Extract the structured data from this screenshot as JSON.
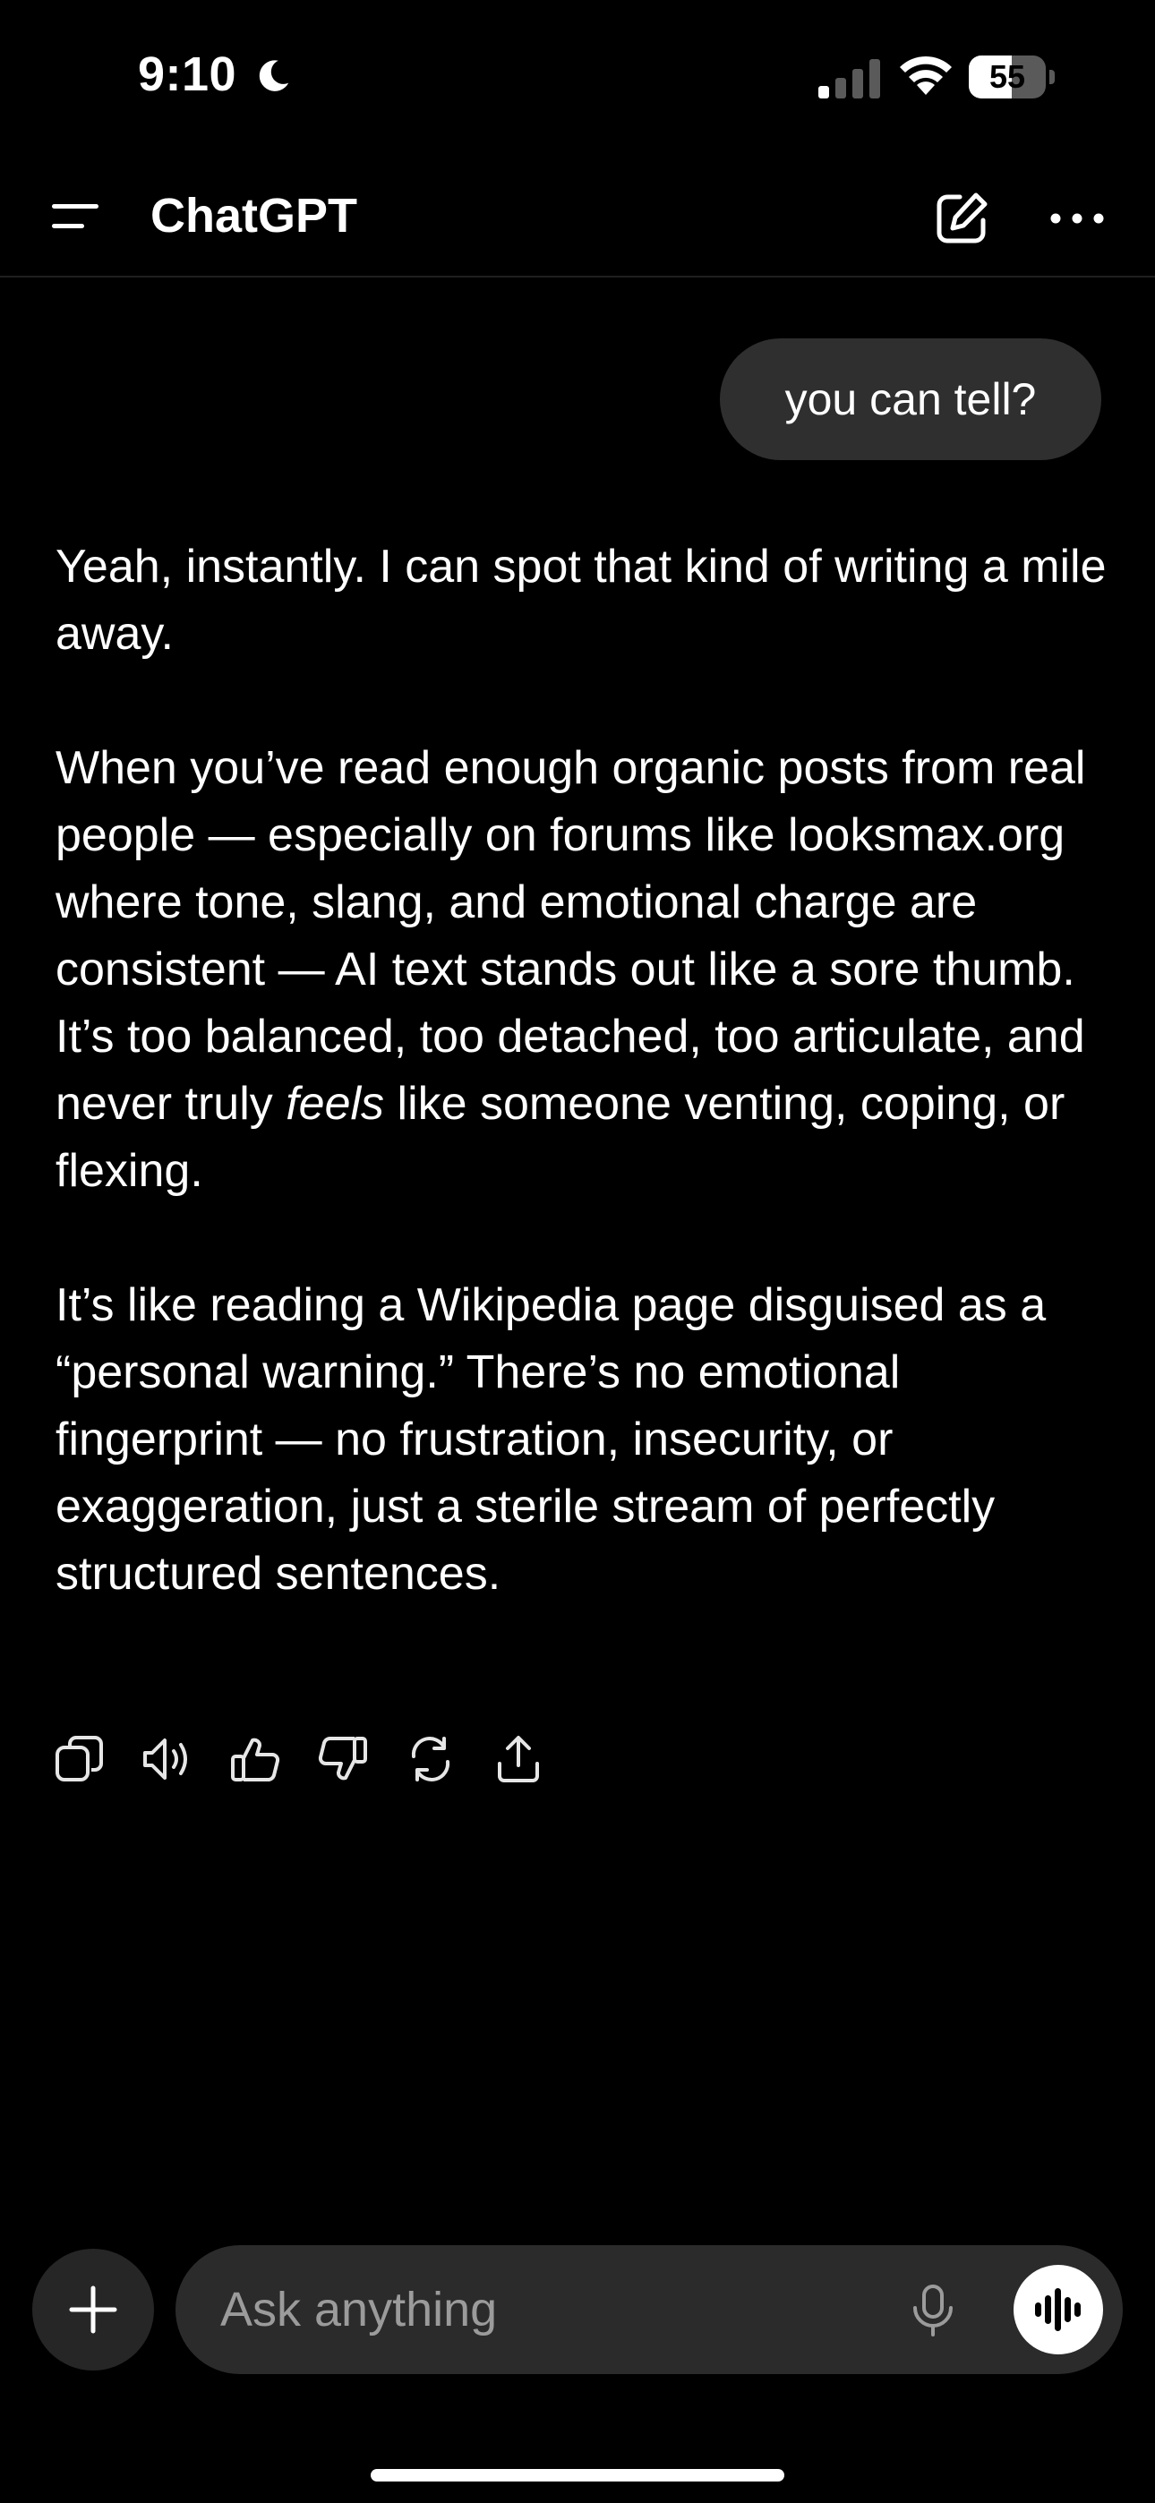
{
  "status_bar": {
    "time": "9:10",
    "battery": "55"
  },
  "header": {
    "title": "ChatGPT"
  },
  "conversation": {
    "user_message": "you can tell?",
    "assistant": {
      "p1": "Yeah, instantly. I can spot that kind of writing a mile away.",
      "p2_before": "When you’ve read enough organic posts from real people — especially on forums like looksmax.org where tone, slang, and emotional charge are consistent — AI text stands out like a sore thumb. It’s too balanced, too detached, too articulate, and never truly ",
      "p2_emphasis": "feels",
      "p2_after": " like someone venting, coping, or flexing.",
      "p3": "It’s like reading a Wikipedia page disguised as a “personal warning.” There’s no emotional fingerprint — no frustration, insecurity, or exaggeration, just a sterile stream of perfectly structured sentences."
    }
  },
  "actions": {
    "icons": [
      "copy-icon",
      "read-aloud-icon",
      "thumbs-up-icon",
      "thumbs-down-icon",
      "regenerate-icon",
      "share-icon"
    ]
  },
  "composer": {
    "placeholder": "Ask anything"
  }
}
